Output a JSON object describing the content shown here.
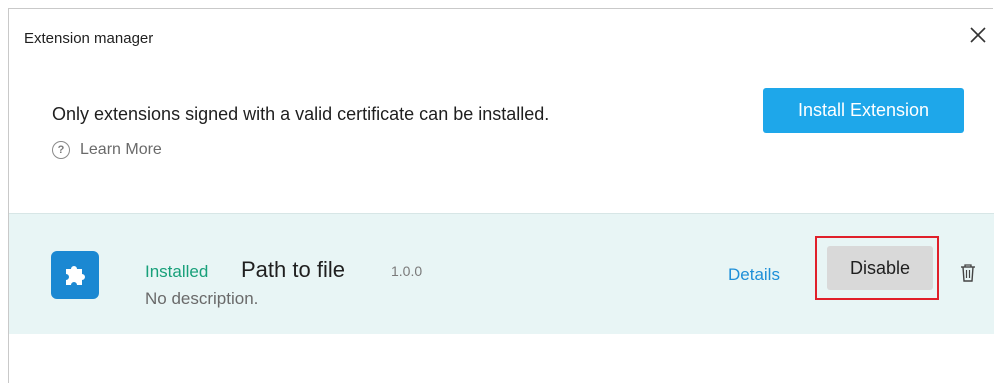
{
  "window": {
    "title": "Extension manager",
    "close_icon": "close-icon"
  },
  "header": {
    "notice": "Only extensions signed with a valid certificate can be installed.",
    "learn_more": "Learn More",
    "learn_more_icon": "question-circle-icon",
    "install_button": "Install Extension"
  },
  "extensions": [
    {
      "icon": "puzzle-piece-icon",
      "status": "Installed",
      "name": "Path to file",
      "version": "1.0.0",
      "description": "No description.",
      "details_label": "Details",
      "disable_label": "Disable",
      "delete_icon": "trash-icon"
    }
  ],
  "colors": {
    "accent": "#1ea7ea",
    "installed": "#18a07a",
    "link": "#1e8fd8",
    "row_bg": "#e8f5f5",
    "highlight": "#e0202a"
  }
}
